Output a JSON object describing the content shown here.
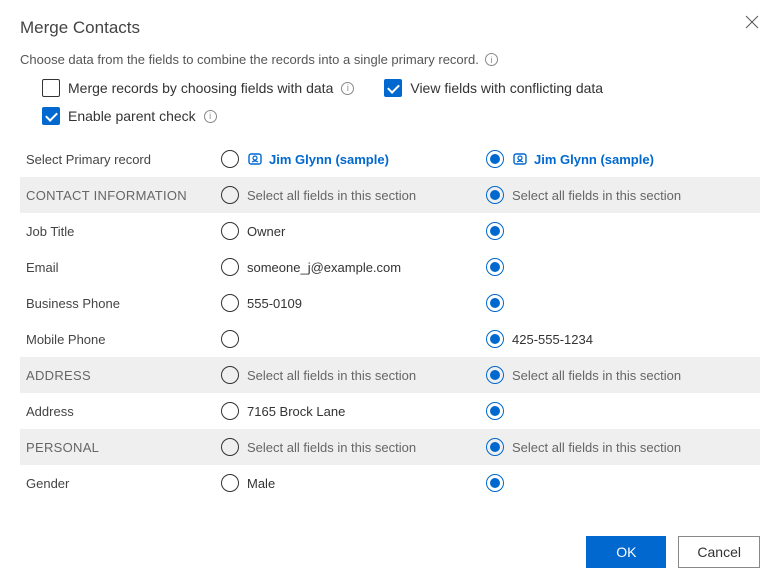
{
  "title": "Merge Contacts",
  "subtitle": "Choose data from the fields to combine the records into a single primary record.",
  "options": {
    "merge_by_fields": {
      "label": "Merge records by choosing fields with data",
      "checked": false
    },
    "view_conflicting": {
      "label": "View fields with conflicting data",
      "checked": true
    },
    "enable_parent": {
      "label": "Enable parent check",
      "checked": true
    }
  },
  "primary_label": "Select Primary record",
  "records": [
    {
      "name": "Jim Glynn (sample)",
      "selected": false
    },
    {
      "name": "Jim Glynn (sample)",
      "selected": true
    }
  ],
  "section_select_label": "Select all fields in this section",
  "sections": [
    {
      "name": "CONTACT INFORMATION",
      "fields": [
        {
          "label": "Job Title",
          "values": [
            "Owner",
            ""
          ],
          "selected": 1
        },
        {
          "label": "Email",
          "values": [
            "someone_j@example.com",
            ""
          ],
          "selected": 1
        },
        {
          "label": "Business Phone",
          "values": [
            "555-0109",
            ""
          ],
          "selected": 1
        },
        {
          "label": "Mobile Phone",
          "values": [
            "",
            "425-555-1234"
          ],
          "selected": 1
        }
      ]
    },
    {
      "name": "ADDRESS",
      "fields": [
        {
          "label": "Address",
          "values": [
            "7165 Brock Lane",
            ""
          ],
          "selected": 1
        }
      ]
    },
    {
      "name": "PERSONAL",
      "fields": [
        {
          "label": "Gender",
          "values": [
            "Male",
            ""
          ],
          "selected": 1
        }
      ]
    }
  ],
  "buttons": {
    "ok": "OK",
    "cancel": "Cancel"
  }
}
